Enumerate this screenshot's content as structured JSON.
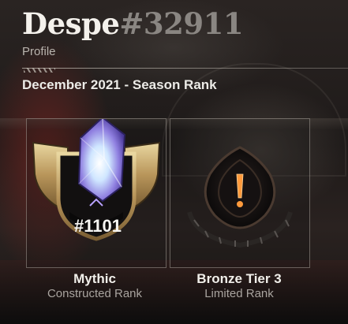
{
  "profile": {
    "display_name": "Despe",
    "tag": "#32911",
    "label": "Profile"
  },
  "season": {
    "title": "December 2021 - Season Rank"
  },
  "ranks": [
    {
      "tier": "Mythic",
      "rank_number": "#1101",
      "format": "Constructed Rank",
      "emblem_icon": "mythic-crystal-icon",
      "accent": "#c7a86a"
    },
    {
      "tier": "Bronze Tier 3",
      "format": "Limited Rank",
      "emblem_icon": "bronze-exclamation-icon",
      "accent": "#e07a2c"
    }
  ]
}
